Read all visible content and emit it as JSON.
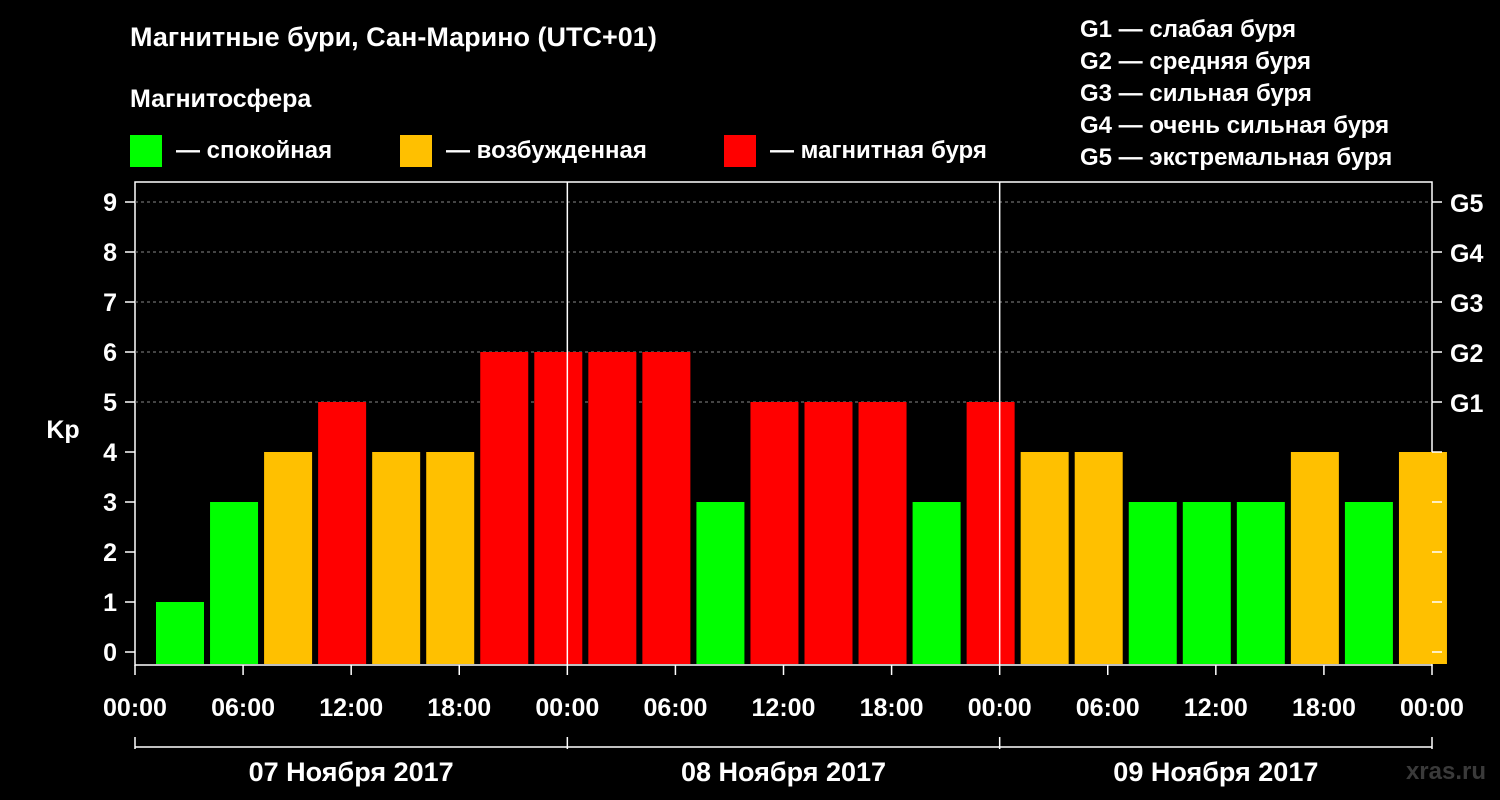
{
  "header": {
    "title": "Магнитные бури, Сан-Марино (UTC+01)",
    "subtitle": "Магнитосфера"
  },
  "legend": [
    {
      "color": "#00ff00",
      "label": "— спокойная"
    },
    {
      "color": "#ffc000",
      "label": "— возбужденная"
    },
    {
      "color": "#ff0000",
      "label": "— магнитная буря"
    }
  ],
  "storm_scale": [
    "G1 — слабая буря",
    "G2 — средняя буря",
    "G3 — сильная буря",
    "G4 — очень сильная буря",
    "G5 — экстремальная буря"
  ],
  "watermark": "xras.ru",
  "chart_data": {
    "type": "bar",
    "title": "Магнитные бури, Сан-Марино (UTC+01)",
    "ylabel": "Kp",
    "ylim": [
      0,
      9
    ],
    "yticks": [
      0,
      1,
      2,
      3,
      4,
      5,
      6,
      7,
      8,
      9
    ],
    "right_axis_labels": [
      {
        "kp": 5,
        "label": "G1"
      },
      {
        "kp": 6,
        "label": "G2"
      },
      {
        "kp": 7,
        "label": "G3"
      },
      {
        "kp": 8,
        "label": "G4"
      },
      {
        "kp": 9,
        "label": "G5"
      }
    ],
    "xtick_labels": [
      "00:00",
      "06:00",
      "12:00",
      "18:00",
      "00:00",
      "06:00",
      "12:00",
      "18:00",
      "00:00",
      "06:00",
      "12:00",
      "18:00",
      "00:00"
    ],
    "days": [
      "07 Ноября 2017",
      "08 Ноября 2017",
      "09 Ноября 2017"
    ],
    "level_colors": {
      "quiet": "#00ff00",
      "active": "#ffc000",
      "storm": "#ff0000"
    },
    "values": [
      1,
      3,
      4,
      5,
      4,
      4,
      6,
      6,
      6,
      6,
      3,
      5,
      5,
      5,
      3,
      5,
      4,
      4,
      3,
      3,
      3,
      4,
      3,
      4
    ],
    "levels": [
      "quiet",
      "quiet",
      "active",
      "storm",
      "active",
      "active",
      "storm",
      "storm",
      "storm",
      "storm",
      "quiet",
      "storm",
      "storm",
      "storm",
      "quiet",
      "storm",
      "active",
      "active",
      "quiet",
      "quiet",
      "quiet",
      "active",
      "quiet",
      "active"
    ],
    "grid": true
  }
}
